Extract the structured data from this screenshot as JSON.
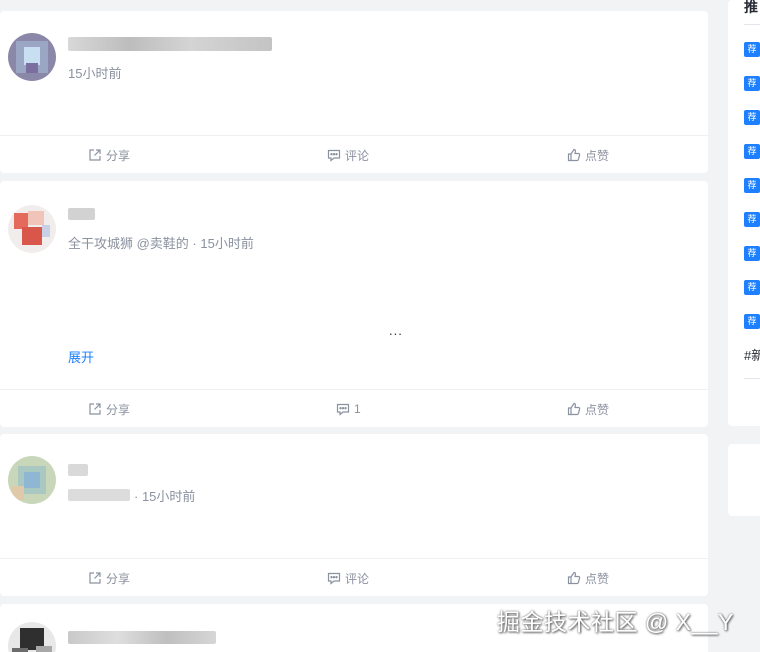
{
  "posts": [
    {
      "time": "15小时前",
      "actions": {
        "share": "分享",
        "comment": "评论",
        "like": "点赞"
      }
    },
    {
      "subtitle": "全干攻城狮 @卖鞋的 · 15小时前",
      "ellipsis": "...",
      "expand": "展开",
      "actions": {
        "share": "分享",
        "comment": "1",
        "like": "点赞"
      }
    },
    {
      "time": "· 15小时前",
      "actions": {
        "share": "分享",
        "comment": "评论",
        "like": "点赞"
      }
    },
    {}
  ],
  "sidebar": {
    "title": "推",
    "tag_label": "荐",
    "topic": "#新"
  },
  "watermark": "掘金技术社区 @ X__Y",
  "colors": {
    "accent": "#1e80ff",
    "muted": "#8a919f",
    "page_bg": "#f2f3f5"
  },
  "icons": [
    "share-icon",
    "comment-icon",
    "like-icon"
  ]
}
